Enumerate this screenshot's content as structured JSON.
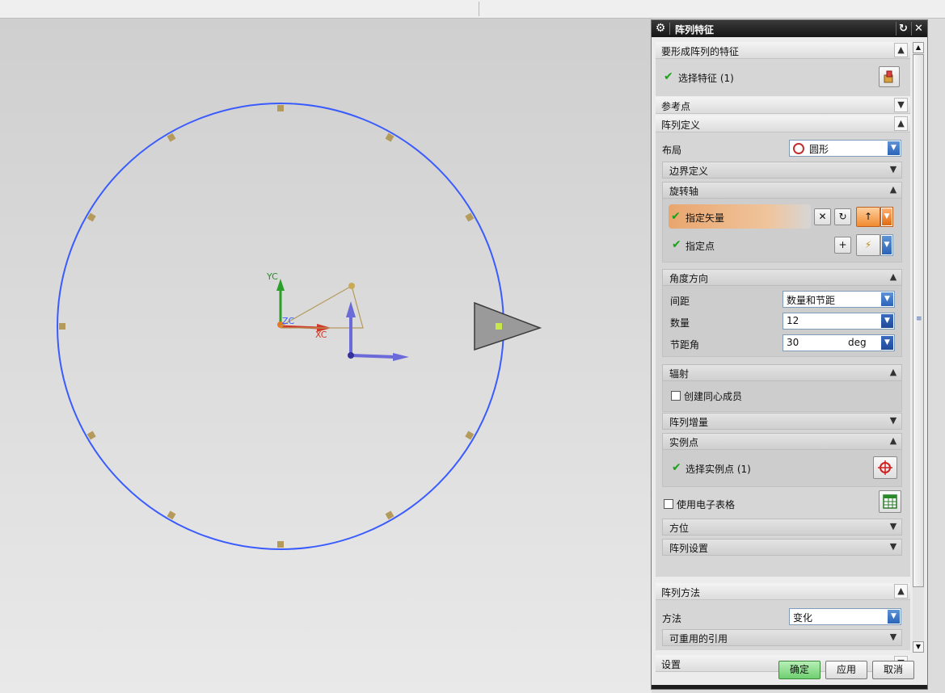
{
  "dialog": {
    "title": "阵列特征",
    "icons": {
      "gear": "gear-icon",
      "reset": "reset-icon",
      "close": "close-icon"
    },
    "sections": {
      "features": {
        "header": "要形成阵列的特征",
        "select_label": "选择特征 (1)"
      },
      "reference_point": {
        "header": "参考点"
      },
      "pattern_definition": {
        "header": "阵列定义",
        "layout_label": "布局",
        "layout_value": "圆形",
        "boundary": {
          "header": "边界定义"
        },
        "rotation_axis": {
          "header": "旋转轴",
          "vector_label": "指定矢量",
          "point_label": "指定点"
        },
        "angle_direction": {
          "header": "角度方向",
          "spacing_label": "间距",
          "spacing_value": "数量和节距",
          "count_label": "数量",
          "count_value": "12",
          "pitch_label": "节距角",
          "pitch_value": "30",
          "pitch_unit": "deg"
        },
        "radiate": {
          "header": "辐射",
          "concentric_label": "创建同心成员"
        },
        "increment": {
          "header": "阵列增量"
        },
        "instance_points": {
          "header": "实例点",
          "select_label": "选择实例点 (1)"
        },
        "spreadsheet_label": "使用电子表格",
        "orientation": {
          "header": "方位"
        },
        "pattern_settings": {
          "header": "阵列设置"
        }
      },
      "pattern_method": {
        "header": "阵列方法",
        "method_label": "方法",
        "method_value": "变化",
        "reusable": {
          "header": "可重用的引用"
        }
      },
      "settings": {
        "header": "设置"
      }
    },
    "buttons": {
      "ok": "确定",
      "apply": "应用",
      "cancel": "取消"
    },
    "colors": {
      "ok_button": "#7fd47f",
      "highlight_row": "#e9a66e",
      "accent_blue": "#2b64b8"
    }
  },
  "viewport": {
    "axis_labels": {
      "yc": "YC",
      "xc": "XC",
      "zc": "ZC"
    },
    "colors": {
      "circle": "#3a5cff",
      "instance_marker": "#b49b5c",
      "yc_axis": "#2aa02a",
      "xc_axis": "#d03a2a",
      "vector": "#6a6ad8"
    }
  }
}
